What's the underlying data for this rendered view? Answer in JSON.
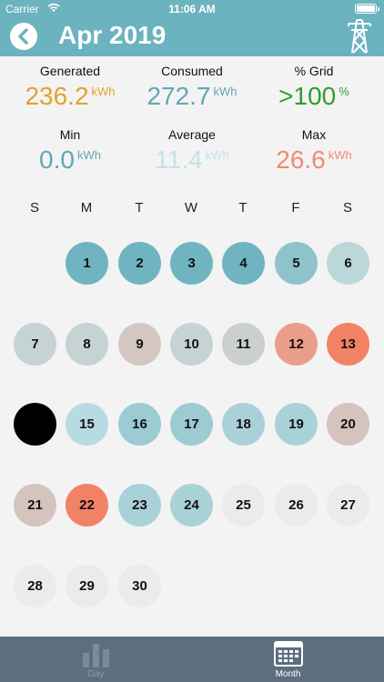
{
  "status_bar": {
    "carrier": "Carrier",
    "time": "11:06 AM"
  },
  "header": {
    "title": "Apr 2019",
    "back_icon": "chevron-left-icon",
    "action_icon": "power-tower-icon"
  },
  "stats": {
    "generated": {
      "label": "Generated",
      "value": "236.2",
      "unit": "kWh",
      "color": "#e0a32c"
    },
    "consumed": {
      "label": "Consumed",
      "value": "272.7",
      "unit": "kWh",
      "color": "#63a7b6"
    },
    "grid": {
      "label": "% Grid",
      "value": ">100",
      "unit": "%",
      "color": "#2e9e2e"
    },
    "min": {
      "label": "Min",
      "value": "0.0",
      "unit": "kWh",
      "color": "#63a7b6"
    },
    "average": {
      "label": "Average",
      "value": "11.4",
      "unit": "kWh",
      "color": "#c6e0e6"
    },
    "max": {
      "label": "Max",
      "value": "26.6",
      "unit": "kWh",
      "color": "#ef8b73"
    }
  },
  "weekdays": [
    "S",
    "M",
    "T",
    "W",
    "T",
    "F",
    "S"
  ],
  "colors": {
    "teal": "#70b4c1",
    "teal_light": "#a3d0d7",
    "grey_blue": "#c2d3d5",
    "taupe": "#d4c4bd",
    "salmon": "#e99e8a",
    "coral": "#f28266",
    "black": "#000000",
    "empty": "#ebebeb"
  },
  "days": [
    {
      "label": "1",
      "color": "#70b4c1"
    },
    {
      "label": "2",
      "color": "#70b4c1"
    },
    {
      "label": "3",
      "color": "#70b4c1"
    },
    {
      "label": "4",
      "color": "#70b4c1"
    },
    {
      "label": "5",
      "color": "#8fc3cc"
    },
    {
      "label": "6",
      "color": "#bcd7da"
    },
    {
      "label": "7",
      "color": "#c5d3d4"
    },
    {
      "label": "8",
      "color": "#c5d3d4"
    },
    {
      "label": "9",
      "color": "#d4c7c2"
    },
    {
      "label": "10",
      "color": "#c5d3d4"
    },
    {
      "label": "11",
      "color": "#cbcfcf"
    },
    {
      "label": "12",
      "color": "#e99e8a"
    },
    {
      "label": "13",
      "color": "#f28266"
    },
    {
      "label": "",
      "color": "#000000"
    },
    {
      "label": "15",
      "color": "#b7dbe0"
    },
    {
      "label": "16",
      "color": "#9ccbd3"
    },
    {
      "label": "17",
      "color": "#9ccbd3"
    },
    {
      "label": "18",
      "color": "#a9d1d8"
    },
    {
      "label": "19",
      "color": "#a9d1d8"
    },
    {
      "label": "20",
      "color": "#d4c4bd"
    },
    {
      "label": "21",
      "color": "#d4c4bd"
    },
    {
      "label": "22",
      "color": "#f28266"
    },
    {
      "label": "23",
      "color": "#a9d1d8"
    },
    {
      "label": "24",
      "color": "#a9d1d8"
    },
    {
      "label": "25",
      "color": "#ebebeb"
    },
    {
      "label": "26",
      "color": "#ebebeb"
    },
    {
      "label": "27",
      "color": "#ebebeb"
    },
    {
      "label": "28",
      "color": "#ebebeb"
    },
    {
      "label": "29",
      "color": "#ebebeb"
    },
    {
      "label": "30",
      "color": "#ebebeb"
    }
  ],
  "first_weekday_index": 1,
  "tabs": [
    {
      "label": "Day",
      "icon": "bar-chart-icon",
      "active": false
    },
    {
      "label": "Month",
      "icon": "calendar-icon",
      "active": true
    }
  ]
}
